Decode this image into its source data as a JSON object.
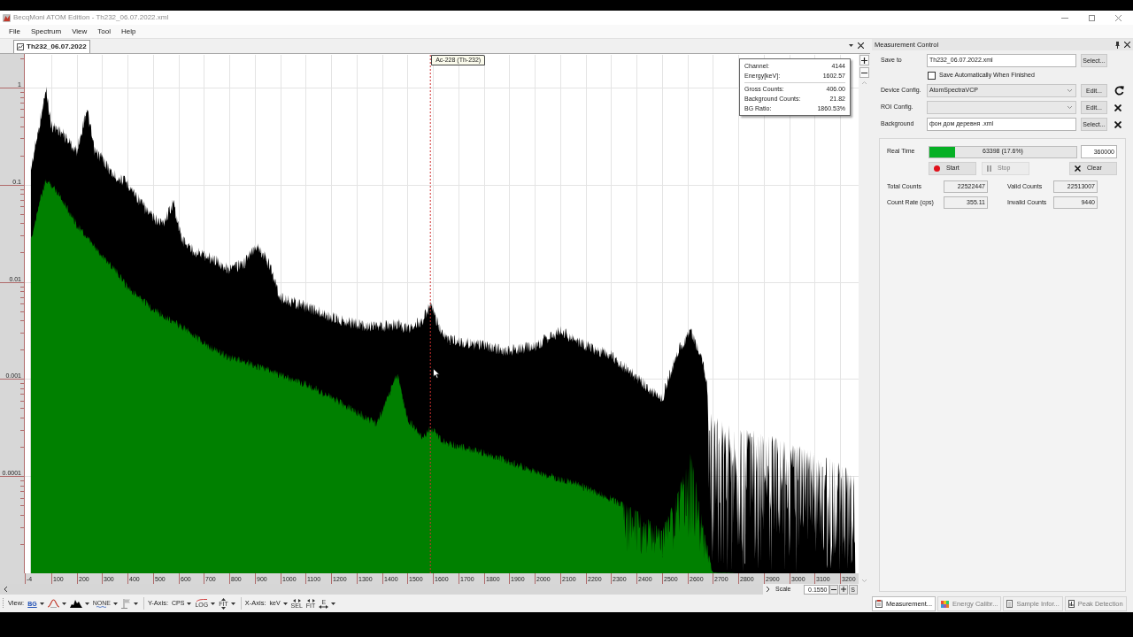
{
  "window": {
    "title": "BecqMoni ATOM Edition - Th232_06.07.2022.xml"
  },
  "menu": [
    "File",
    "Spectrum",
    "View",
    "Tool",
    "Help"
  ],
  "document_tabs": [
    {
      "label": "Th232_06.07.2022",
      "selected": true
    }
  ],
  "spectrum": {
    "marker_label": "Ac-228 (Th-232)",
    "y_axis_labels": [
      "1",
      "0.1",
      "0.01",
      "0.001",
      "0.0001"
    ],
    "x_axis_labels": [
      "-4",
      "100",
      "200",
      "300",
      "400",
      "500",
      "600",
      "700",
      "800",
      "900",
      "1000",
      "1100",
      "1200",
      "1300",
      "1400",
      "1500",
      "1600",
      "1700",
      "1800",
      "1900",
      "2000",
      "2100",
      "2200",
      "2300",
      "2400",
      "2500",
      "2600",
      "2700",
      "2800",
      "2900",
      "3000",
      "3100",
      "3200"
    ],
    "cursor_readout": {
      "sections": [
        {
          "rows": [
            {
              "label": "Channel:",
              "value": "4144"
            },
            {
              "label": "Energy[keV]:",
              "value": "1602.57"
            }
          ]
        },
        {
          "rows": [
            {
              "label": "Gross Counts:",
              "value": "406.00"
            },
            {
              "label": "Background Counts:",
              "value": "21.82"
            },
            {
              "label": "BG Ratio:",
              "value": "1860.53%"
            }
          ]
        }
      ]
    },
    "scale": {
      "label": "Scale",
      "value": "0.1550",
      "reset_button": "S"
    }
  },
  "toolbar": {
    "groups": [
      {
        "label": "View:",
        "buttons": [
          {
            "label": "BG",
            "dropdown": true
          },
          {
            "dropdown": true
          },
          {
            "dropdown": true
          },
          {
            "label": "NONE",
            "dropdown": true
          },
          {
            "dropdown": true
          }
        ]
      },
      {
        "label": "Y-Axis:",
        "unit": "CPS",
        "buttons": [
          {
            "label": "LOG",
            "dropdown": true
          },
          {
            "label": "FIT",
            "dropdown": true
          }
        ]
      },
      {
        "label": "X-Axis:",
        "unit": "keV",
        "buttons": [
          {
            "label": "SEL",
            "dropdown": false
          },
          {
            "label": "FIT",
            "dropdown": false
          },
          {
            "label": "E",
            "dropdown": true
          }
        ]
      }
    ]
  },
  "measurement_panel": {
    "title": "Measurement Control",
    "rows": [
      {
        "kind": "text",
        "label": "Save to",
        "value": "Th232_06.07.2022.xml",
        "button": "Select..."
      },
      {
        "kind": "checkbox",
        "label": "Save Automatically When Finished",
        "checked": false
      },
      {
        "kind": "dropdown",
        "label": "Device Config.",
        "value": "AtomSpectraVCP",
        "button": "Edit...",
        "side_button": {
          "kind": "reload"
        }
      },
      {
        "kind": "dropdown",
        "label": "ROI Config.",
        "button": "Edit...",
        "side_button": {
          "kind": "clear"
        }
      },
      {
        "kind": "text",
        "label": "Background",
        "value": "фон дом деревня .xml",
        "button": "Select...",
        "side_button": {
          "kind": "clear"
        }
      }
    ],
    "acquisition": {
      "real_time": {
        "label": "Real Time",
        "level": 0.176,
        "reading": "63398 (17.6%)",
        "limit": "360000"
      },
      "buttons": [
        {
          "kind": "start",
          "label": "Start",
          "disabled": false
        },
        {
          "kind": "stop",
          "label": "Stop",
          "disabled": true
        },
        {
          "kind": "clear",
          "label": "Clear",
          "disabled": false
        }
      ],
      "counts": [
        {
          "label": "Total Counts",
          "value": "22522447"
        },
        {
          "label": "Valid Counts",
          "value": "22513007"
        },
        {
          "label": "Count Rate (cps)",
          "value": "355.11"
        },
        {
          "label": "Invalid Counts",
          "value": "9440"
        }
      ]
    }
  },
  "panel_tabs": [
    {
      "label": "Measurement...",
      "selected": true
    },
    {
      "label": "Energy Calibr...",
      "selected": false
    },
    {
      "label": "Sample Infor...",
      "selected": false
    },
    {
      "label": "Peak Detection",
      "selected": false
    }
  ]
}
